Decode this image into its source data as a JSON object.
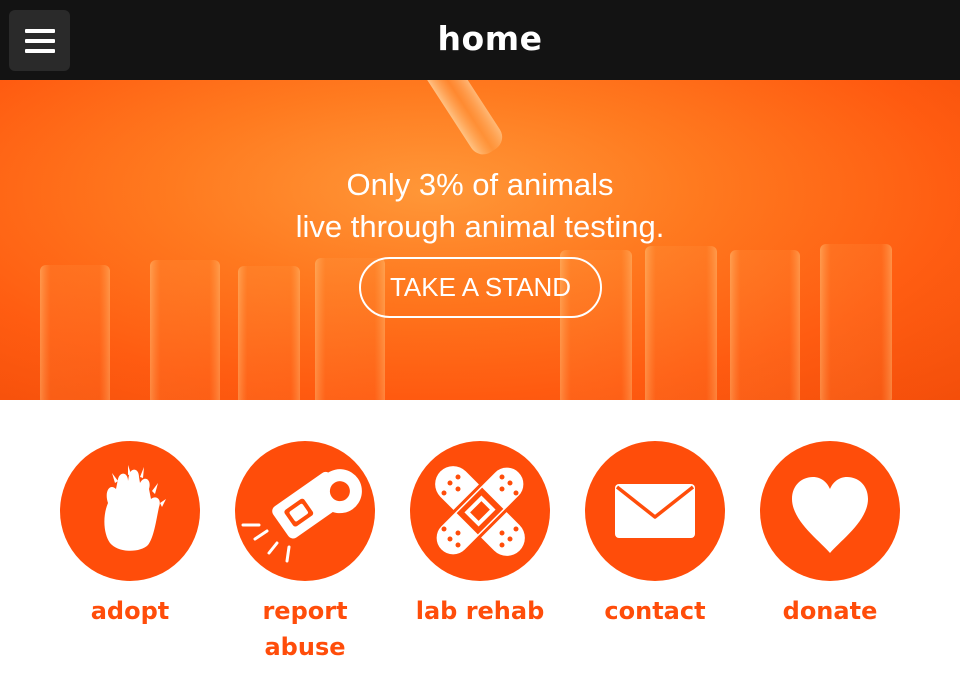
{
  "header": {
    "title": "home",
    "menu_icon": "hamburger-menu-icon"
  },
  "hero": {
    "line1": "Only 3% of animals",
    "line2": "live through animal testing.",
    "cta_label": "TAKE A STAND"
  },
  "actions": [
    {
      "label": "adopt",
      "icon": "paw-icon"
    },
    {
      "label": "report abuse",
      "icon": "whistle-icon"
    },
    {
      "label": "lab rehab",
      "icon": "bandage-icon"
    },
    {
      "label": "contact",
      "icon": "envelope-icon"
    },
    {
      "label": "donate",
      "icon": "heart-icon"
    }
  ],
  "colors": {
    "accent": "#ff4d0a",
    "topbar": "#131313",
    "hero": "#ff7a1f"
  }
}
